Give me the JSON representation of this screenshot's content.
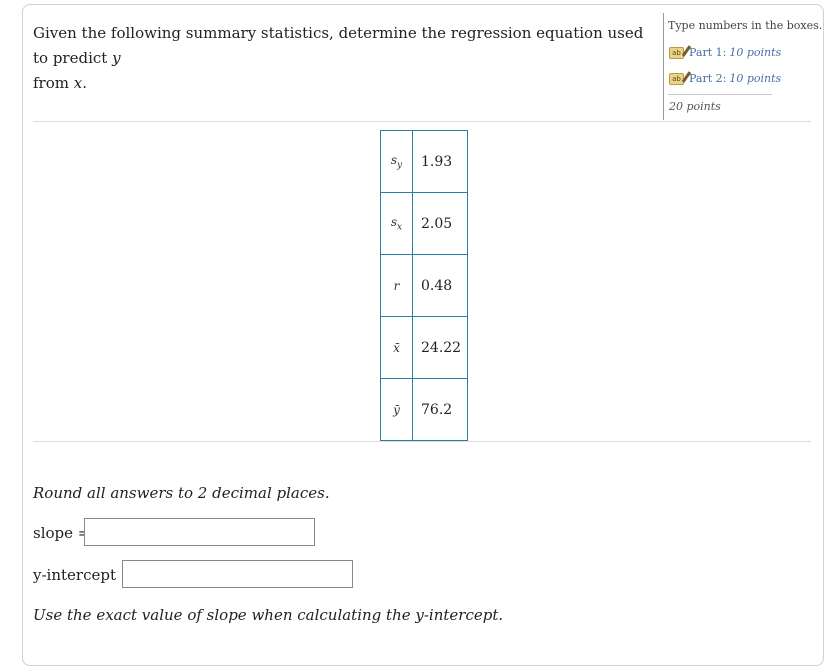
{
  "question": {
    "text_before": "Given the following summary statistics, determine the regression equation used to predict ",
    "var_y": "y",
    "text_mid": "from ",
    "var_x": "x",
    "text_end": "."
  },
  "sidebar": {
    "instruction": "Type numbers in the boxes.",
    "parts": [
      {
        "label": "Part 1:",
        "points": "10 points"
      },
      {
        "label": "Part 2:",
        "points": "10 points"
      }
    ],
    "total": "20 points"
  },
  "stats_table": [
    {
      "symbol": "s_y",
      "display": "s",
      "sub": "y",
      "value": "1.93"
    },
    {
      "symbol": "s_x",
      "display": "s",
      "sub": "x",
      "value": "2.05"
    },
    {
      "symbol": "r",
      "display": "r",
      "sub": "",
      "value": "0.48"
    },
    {
      "symbol": "x_bar",
      "display": "x̄",
      "sub": "",
      "value": "24.22"
    },
    {
      "symbol": "y_bar",
      "display": "ȳ",
      "sub": "",
      "value": "76.2"
    }
  ],
  "instructions": {
    "round": "Round all answers to 2 decimal places.",
    "slope_label": "slope =",
    "intercept_label": "y-intercept =",
    "note": "Use the exact value of slope when calculating the y-intercept."
  },
  "inputs": {
    "slope_value": "",
    "intercept_value": ""
  }
}
